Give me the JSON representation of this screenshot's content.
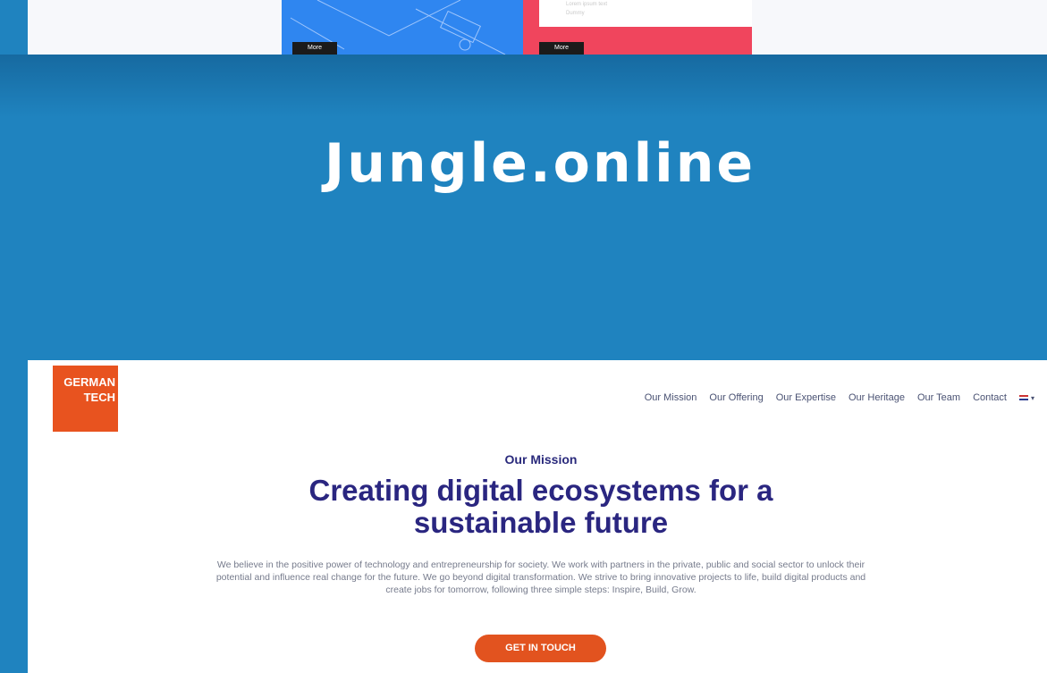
{
  "top_preview": {
    "tiles": [
      {
        "more_label": "More"
      },
      {
        "more_label": "More",
        "faint_text": [
          "Lorem ipsum text",
          "Dummy"
        ]
      }
    ]
  },
  "hero": {
    "title": "Jungle.online"
  },
  "website_preview": {
    "logo": {
      "line1": "GERMAN",
      "line2": "TECH"
    },
    "nav": {
      "items": [
        "Our Mission",
        "Our Offering",
        "Our Expertise",
        "Our Heritage",
        "Our Team",
        "Contact"
      ]
    },
    "eyebrow": "Our Mission",
    "headline": {
      "line1": "Creating digital ecosystems for a",
      "line2": "sustainable future"
    },
    "paragraph": "We believe in the positive power of technology and entrepreneurship for society. We work with partners in the private, public and social sector to unlock their potential and influence real change for the future. We go beyond digital transformation. We strive to bring innovative projects to life, build digital products and create jobs for tomorrow, following three simple steps: Inspire, Build, Grow.",
    "cta_label": "GET IN TOUCH",
    "colors": {
      "brand_orange": "#e8531f",
      "headline_navy": "#2a2680",
      "background_blue": "#1f83bf"
    }
  }
}
